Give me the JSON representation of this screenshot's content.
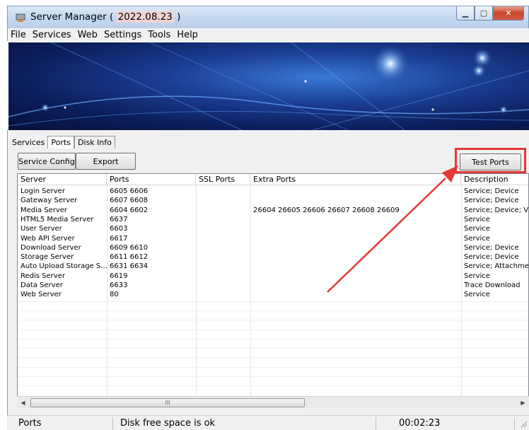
{
  "window": {
    "title_prefix": "Server Manager ( ",
    "title_date": "2022.08.23",
    "title_suffix": " )"
  },
  "menu": [
    "File",
    "Services",
    "Web",
    "Settings",
    "Tools",
    "Help"
  ],
  "tabs": [
    "Services",
    "Ports",
    "Disk Info"
  ],
  "active_tab": "Ports",
  "toolbar": {
    "service_config": "Service Config",
    "export": "Export",
    "test_ports": "Test Ports"
  },
  "table": {
    "columns": [
      "Server",
      "Ports",
      "SSL Ports",
      "Extra Ports",
      "Description"
    ],
    "rows": [
      [
        "Login Server",
        "6605 6606",
        "",
        "",
        "Service; Device"
      ],
      [
        "Gateway Server",
        "6607 6608",
        "",
        "",
        "Service; Device"
      ],
      [
        "Media Server",
        "6604 6602",
        "",
        "26604 26605 26606 26607 26608 26609",
        "Service; Device; V"
      ],
      [
        "HTML5 Media Server",
        "6637",
        "",
        "",
        "Service"
      ],
      [
        "User Server",
        "6603",
        "",
        "",
        "Service"
      ],
      [
        "Web API Server",
        "6617",
        "",
        "",
        "Service"
      ],
      [
        "Download Server",
        "6609 6610",
        "",
        "",
        "Service; Device"
      ],
      [
        "Storage Server",
        "6611 6612",
        "",
        "",
        "Service; Device"
      ],
      [
        "Auto Upload Storage S...",
        "6631 6634",
        "",
        "",
        "Service; Attachme"
      ],
      [
        "Redis Server",
        "6619",
        "",
        "",
        "Service"
      ],
      [
        "Data Server",
        "6633",
        "",
        "",
        "Trace Download"
      ],
      [
        "Web Server",
        "80",
        "",
        "",
        "Service"
      ]
    ]
  },
  "scrollbar": {
    "thumb_grip": "III"
  },
  "status": {
    "left": "Ports",
    "middle": "Disk free space is ok",
    "time": "00:02:23"
  },
  "colors": {
    "highlight": "#e53935",
    "titlebar": "#c5d9f1"
  }
}
